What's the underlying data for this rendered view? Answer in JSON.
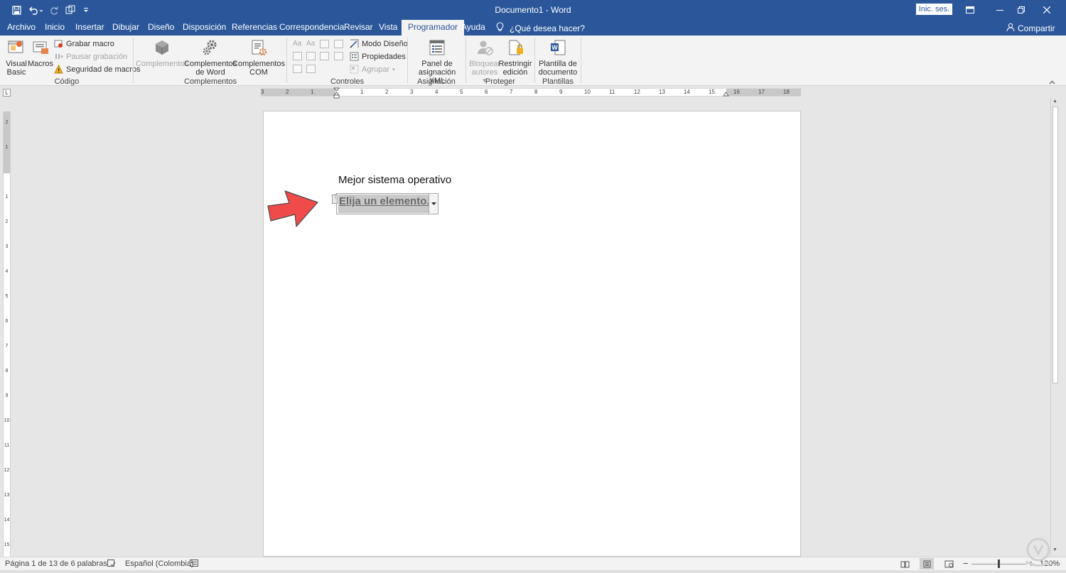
{
  "titlebar": {
    "title": "Documento1 - Word",
    "signin_label": "Inic. ses.",
    "qat_icons": [
      "save-icon",
      "undo-icon",
      "redo-icon",
      "touch-mode-icon",
      "customize-qat-icon"
    ],
    "window_controls": [
      "ribbon-display-icon",
      "minimize-icon",
      "restore-icon",
      "close-icon"
    ]
  },
  "tabs": [
    {
      "label": "Archivo"
    },
    {
      "label": "Inicio"
    },
    {
      "label": "Insertar"
    },
    {
      "label": "Dibujar"
    },
    {
      "label": "Diseño"
    },
    {
      "label": "Disposición"
    },
    {
      "label": "Referencias"
    },
    {
      "label": "Correspondencia"
    },
    {
      "label": "Revisar"
    },
    {
      "label": "Vista"
    },
    {
      "label": "Programador"
    },
    {
      "label": "Ayuda"
    }
  ],
  "active_tab": "Programador",
  "tellme": {
    "label": "¿Qué desea hacer?"
  },
  "share": {
    "label": "Compartir"
  },
  "ribbon": {
    "codigo": {
      "label": "Código",
      "visual_basic": [
        "Visual",
        "Basic"
      ],
      "macros": "Macros",
      "grabar_macro": "Grabar macro",
      "pausar_grabacion": "Pausar grabación",
      "seguridad_macros": "Seguridad de macros"
    },
    "complementos": {
      "label": "Complementos",
      "complementos": "Complementos",
      "complementos_word": [
        "Complementos",
        "de Word"
      ],
      "complementos_com": [
        "Complementos",
        "COM"
      ]
    },
    "controles": {
      "label": "Controles",
      "modo_diseno": "Modo Diseño",
      "propiedades": "Propiedades",
      "agrupar": "Agrupar"
    },
    "asignacion": {
      "label": "Asignación",
      "panel": [
        "Panel de",
        "asignación XML"
      ]
    },
    "proteger": {
      "label": "Proteger",
      "bloquear": [
        "Bloquear",
        "autores"
      ],
      "restringir": [
        "Restringir",
        "edición"
      ]
    },
    "plantillas": {
      "label": "Plantillas",
      "plantilla_doc": [
        "Plantilla de",
        "documento"
      ]
    }
  },
  "ruler": {
    "h_labels": [
      "3",
      "2",
      "1",
      "1",
      "2",
      "3",
      "4",
      "5",
      "6",
      "7",
      "8",
      "9",
      "10",
      "11",
      "12",
      "13",
      "14",
      "15",
      "16",
      "17",
      "18"
    ],
    "v_labels": [
      "2",
      "1",
      "1",
      "2",
      "3",
      "4",
      "5",
      "6",
      "7",
      "8",
      "9",
      "10",
      "11",
      "12",
      "13",
      "14",
      "15"
    ]
  },
  "document": {
    "heading": "Mejor sistema operativo",
    "content_control_placeholder": "Elija un elemento."
  },
  "status": {
    "page": "Página 1 de 1",
    "words": "3 de 6 palabras",
    "language": "Español (Colombia)",
    "zoom": "120%"
  },
  "colors": {
    "word_blue": "#2b579a",
    "ribbon_bg": "#f3f3f3",
    "arrow_red": "#f04a4a"
  }
}
